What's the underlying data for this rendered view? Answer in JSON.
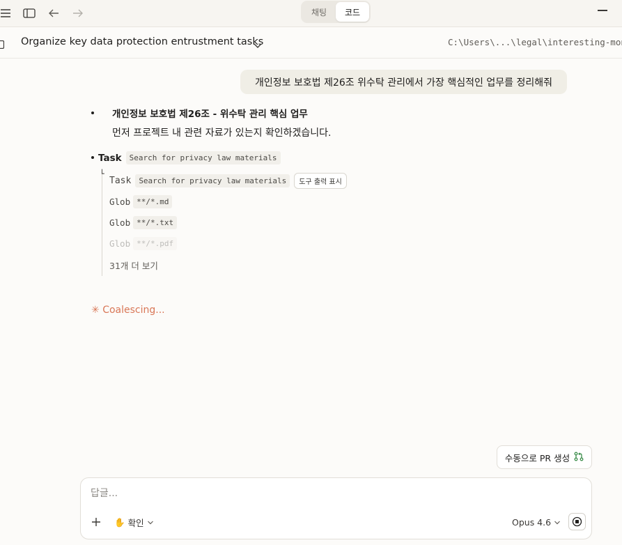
{
  "top_bar": {
    "tabs": [
      {
        "label": "채팅",
        "active": false
      },
      {
        "label": "코드",
        "active": true
      }
    ]
  },
  "session": {
    "title": "Organize key data protection entrustment tasks",
    "path": "C:\\Users\\...\\legal\\interesting-mont"
  },
  "conversation": {
    "user_message": "개인정보 보호법 제26조 위수탁 관리에서 가장 핵심적인 업무를 정리해줘",
    "assistant_heading": "개인정보 보호법 제26조 - 위수탁 관리 핵심 업무",
    "assistant_paragraph": "먼저 프로젝트 내 관련 자료가 있는지 확인하겠습니다.",
    "task": {
      "label": "Task",
      "description": "Search for privacy law materials",
      "subtask": {
        "label": "Task",
        "description": "Search for privacy law materials",
        "tool_button": "도구 출력 표시"
      },
      "tool_calls": [
        {
          "tool": "Glob",
          "pattern": "**/*.md"
        },
        {
          "tool": "Glob",
          "pattern": "**/*.txt"
        },
        {
          "tool": "Glob",
          "pattern": "**/*.pdf"
        }
      ],
      "more_label": "31개 더 보기"
    },
    "status": "Coalescing..."
  },
  "pr_button": {
    "label": "수동으로 PR 생성"
  },
  "composer": {
    "placeholder": "답글...",
    "mode_label": "확인",
    "model_label": "Opus 4.6"
  },
  "colors": {
    "accent": "#d97757",
    "pr_icon": "#3f8f4e",
    "background": "#fcfbf9"
  }
}
